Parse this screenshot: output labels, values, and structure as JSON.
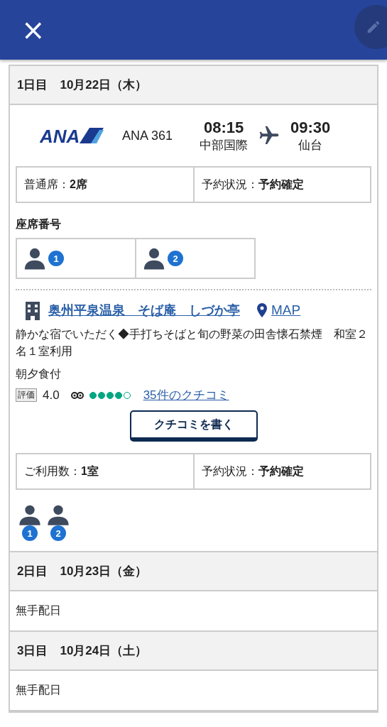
{
  "header": {
    "close": "×"
  },
  "days": [
    {
      "kind": "itinerary",
      "label": "1日目　10月22日（木）",
      "flight": {
        "airline": "ANA",
        "number": "ANA 361",
        "depart_time": "08:15",
        "depart_airport": "中部国際",
        "arrive_time": "09:30",
        "arrive_airport": "仙台",
        "info": [
          {
            "label": "普通席：",
            "value": "2席"
          },
          {
            "label": "予約状況：",
            "value": "予約確定"
          }
        ],
        "seats_title": "座席番号",
        "seats": [
          "1",
          "2"
        ]
      },
      "hotel": {
        "name": "奥州平泉温泉　そば庵　しづか亭",
        "map": "MAP",
        "description": "静かな宿でいただく◆手打ちそばと旬の野菜の田舎懐石禁煙　和室２名１室利用",
        "meals": "朝夕食付",
        "rating_tag": "評価",
        "rating": "4.0",
        "stars": 4,
        "reviews": "35件のクチコミ",
        "write_review": "クチコミを書く",
        "info": [
          {
            "label": "ご利用数：",
            "value": "1室"
          },
          {
            "label": "予約状況：",
            "value": "予約確定"
          }
        ],
        "guests": [
          "1",
          "2"
        ]
      }
    },
    {
      "kind": "empty",
      "label": "2日目　10月23日（金）",
      "note": "無手配日"
    },
    {
      "kind": "empty",
      "label": "3日目　10月24日（土）",
      "note": "無手配日"
    }
  ]
}
